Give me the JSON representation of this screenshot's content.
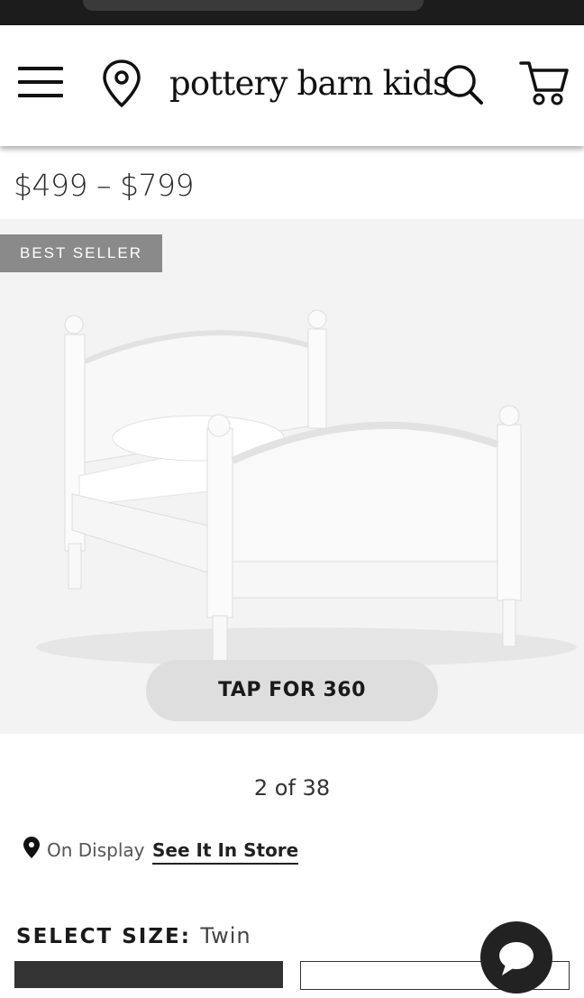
{
  "header": {
    "logo_text": "pottery barn kids",
    "icons": [
      "hamburger-menu-icon",
      "location-pin-icon",
      "search-icon",
      "cart-icon"
    ]
  },
  "product": {
    "price_range": "$499 – $799",
    "badge": "BEST SELLER",
    "tap_360_label": "TAP FOR 360",
    "image_counter": "2 of 38"
  },
  "availability": {
    "on_display_label": "On Display",
    "see_in_store_link": "See It In Store"
  },
  "size_selector": {
    "label": "SELECT SIZE:",
    "selected_value": "Twin"
  },
  "colors": {
    "status_bar": "#1c1c1c",
    "hero_background": "#f3f3f3",
    "badge_background": "#8a8a8a",
    "tap_button_background": "#dedede",
    "chat_button": "#222222"
  }
}
